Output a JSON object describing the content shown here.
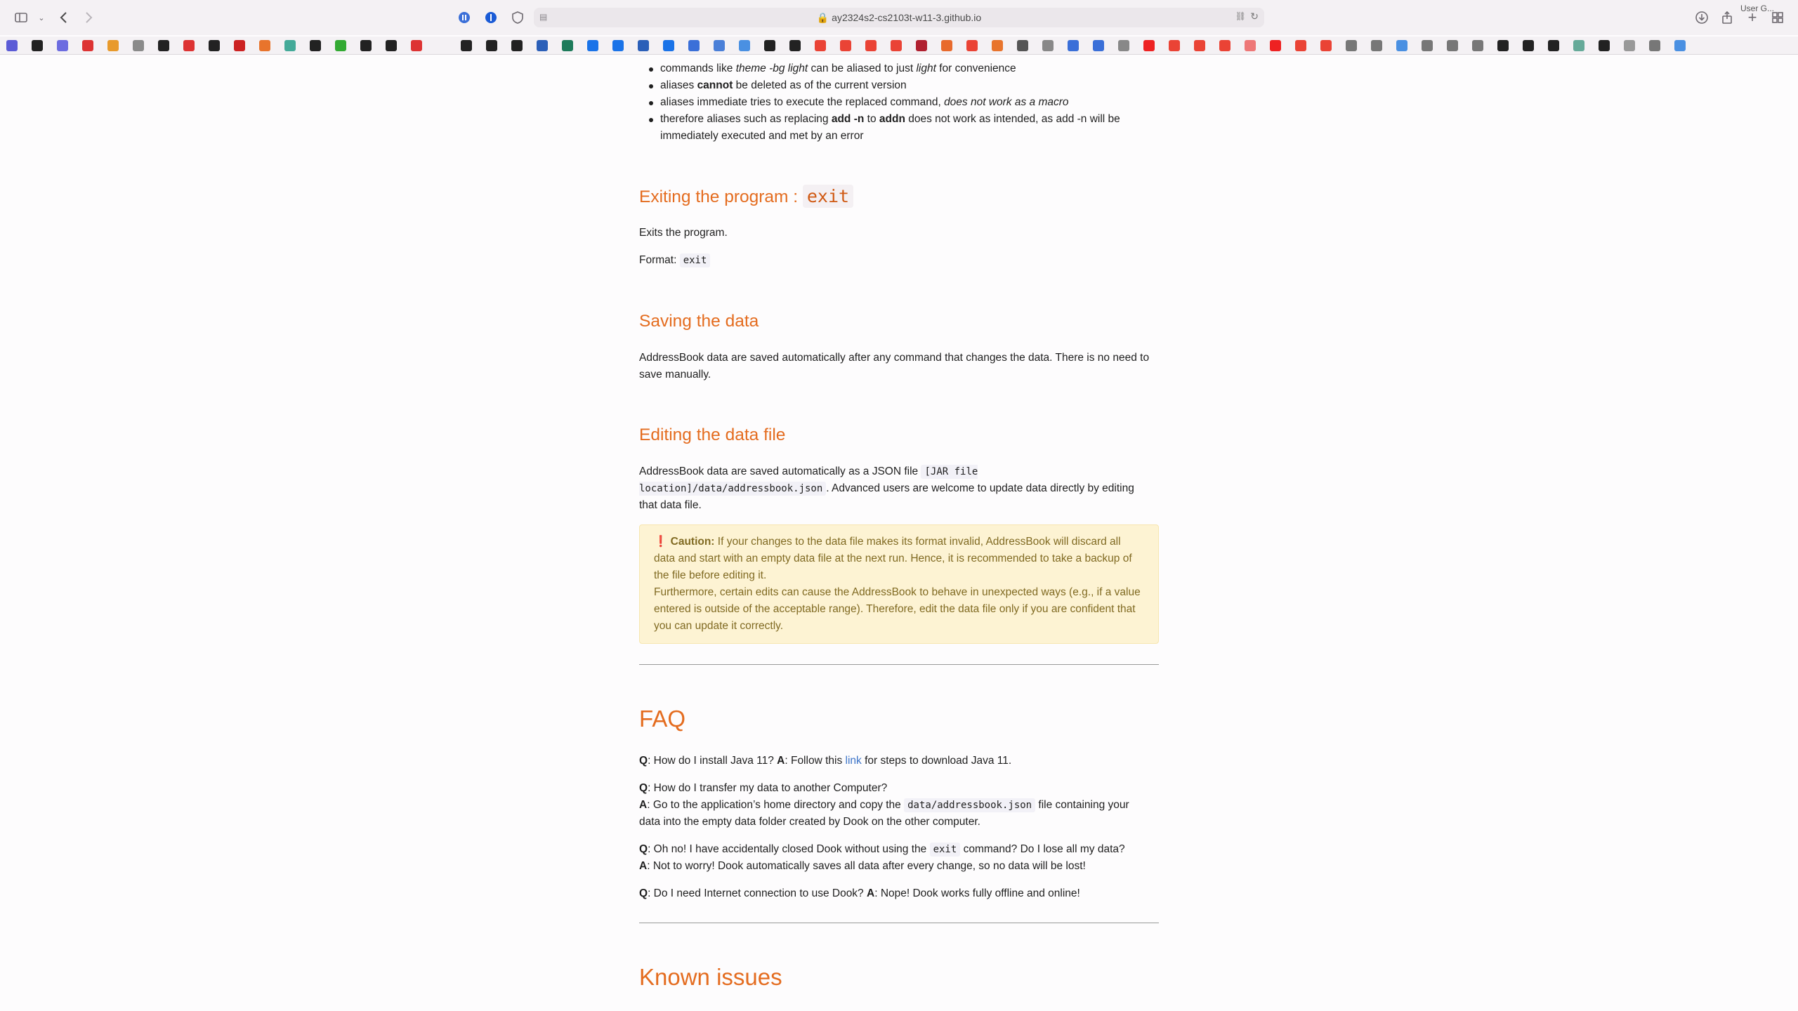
{
  "browser": {
    "url": "ay2324s2-cs2103t-w11-3.github.io",
    "bookmark_user": "User G..."
  },
  "alias_bullets": [
    {
      "pre": "commands like ",
      "em": "theme -bg light",
      "mid": " can be aliased to just ",
      "em2": "light",
      "post": " for convenience"
    },
    {
      "pre": "aliases ",
      "strong": "cannot",
      "post": " be deleted as of the current version"
    },
    {
      "pre": "aliases immediate tries to execute the replaced command, ",
      "em": "does not work as a macro"
    },
    {
      "pre": "therefore aliases such as replacing ",
      "strong": "add -n",
      "mid": " to ",
      "strong2": "addn",
      "post": " does not work as intended, as add -n will be immediately executed and met by an error"
    }
  ],
  "exit_section": {
    "title": "Exiting the program : ",
    "title_code": "exit",
    "desc": "Exits the program.",
    "format_label": "Format: ",
    "format_code": "exit"
  },
  "saving_section": {
    "title": "Saving the data",
    "desc": "AddressBook data are saved automatically after any command that changes the data. There is no need to save manually."
  },
  "editing_section": {
    "title": "Editing the data file",
    "desc_pre": "AddressBook data are saved automatically as a JSON file ",
    "desc_code": "[JAR file location]/data/addressbook.json",
    "desc_post": ". Advanced users are welcome to update data directly by editing that data file.",
    "caution_label": "Caution:",
    "caution_text1": " If your changes to the data file makes its format invalid, AddressBook will discard all data and start with an empty data file at the next run. Hence, it is recommended to take a backup of the file before editing it.",
    "caution_text2": "Furthermore, certain edits can cause the AddressBook to behave in unexpected ways (e.g., if a value entered is outside of the acceptable range). Therefore, edit the data file only if you are confident that you can update it correctly."
  },
  "faq": {
    "title": "FAQ",
    "q_label": "Q",
    "a_label": "A",
    "q1": ": How do I install Java 11? ",
    "a1_pre": ": Follow this ",
    "a1_link": "link",
    "a1_post": " for steps to download Java 11.",
    "q2": ": How do I transfer my data to another Computer?",
    "a2_pre": ": Go to the application’s home directory and copy the ",
    "a2_code": "data/addressbook.json",
    "a2_post": " file containing your data into the empty data folder created by Dook on the other computer.",
    "q3_pre": ": Oh no! I have accidentally closed Dook without using the ",
    "q3_code": "exit",
    "q3_post": " command? Do I lose all my data?",
    "a3": ": Not to worry! Dook automatically saves all data after every change, so no data will be lost!",
    "q4": ": Do I need Internet connection to use Dook? ",
    "a4": ": Nope! Dook works fully offline and online!"
  },
  "known_issues": {
    "title": "Known issues"
  },
  "colors": {
    "heading": "#e46c1f",
    "link": "#3b73c8",
    "caution_bg": "#fdf3d3",
    "caution_text": "#806a22"
  }
}
